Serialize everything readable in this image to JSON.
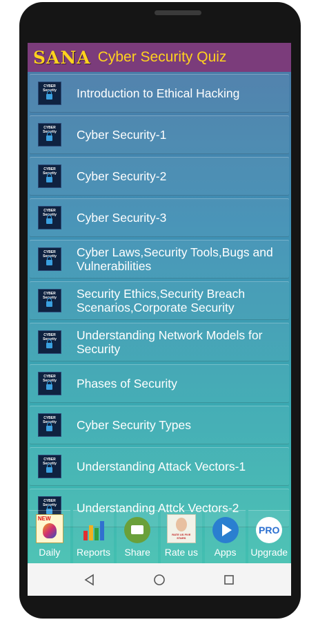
{
  "app": {
    "brand": "SANA",
    "title": "Cyber Security Quiz"
  },
  "thumb": {
    "line1": "CYBER",
    "line2": "Security"
  },
  "items": [
    {
      "label": "Introduction to Ethical Hacking"
    },
    {
      "label": "Cyber Security-1"
    },
    {
      "label": "Cyber Security-2"
    },
    {
      "label": "Cyber Security-3"
    },
    {
      "label": "Cyber Laws,Security Tools,Bugs and Vulnerabilities"
    },
    {
      "label": "Security Ethics,Security Breach Scenarios,Corporate Security"
    },
    {
      "label": "Understanding Network Models for Security"
    },
    {
      "label": "Phases of Security"
    },
    {
      "label": "Cyber Security Types"
    },
    {
      "label": "Understanding Attack Vectors-1"
    },
    {
      "label": "Understanding Attck Vectors-2"
    }
  ],
  "bottom_bar": {
    "daily": "Daily",
    "daily_badge": "NEW",
    "reports": "Reports",
    "share": "Share",
    "rate": "Rate us",
    "rate_badge": "RATE US FIVE STARS",
    "apps": "Apps",
    "upgrade": "Upgrade",
    "upgrade_badge": "PRO"
  },
  "colors": {
    "header_bg": "#7b3c7b",
    "title_color": "#ffd21f",
    "list_gradient_top": "#4a78a6",
    "list_gradient_bottom": "#42bfb0"
  },
  "icons": {
    "nav_back": "back-triangle-icon",
    "nav_home": "home-circle-icon",
    "nav_recents": "recents-square-icon"
  }
}
